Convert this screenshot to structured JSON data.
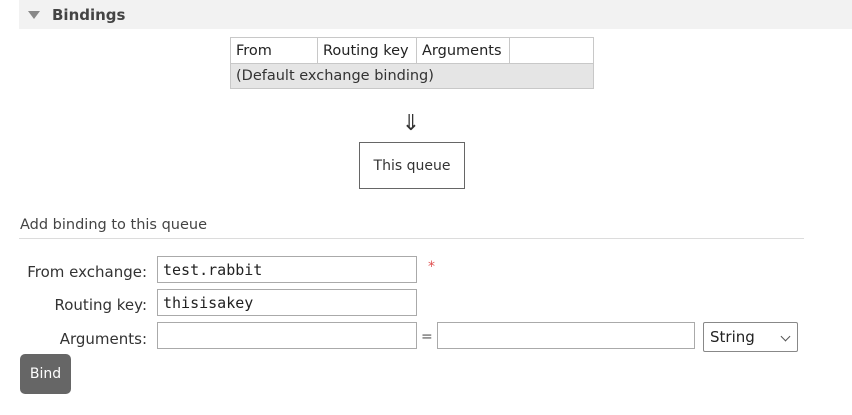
{
  "section": {
    "title": "Bindings"
  },
  "bindings_table": {
    "columns": [
      "From",
      "Routing key",
      "Arguments"
    ],
    "default_row": "(Default exchange binding)"
  },
  "flow": {
    "arrow": "⇓",
    "queue_label": "This queue"
  },
  "add_binding": {
    "title": "Add binding to this queue",
    "from_exchange_label": "From exchange:",
    "from_exchange_value": "test.rabbit",
    "required_marker": "*",
    "routing_key_label": "Routing key:",
    "routing_key_value": "thisisakey",
    "arguments_label": "Arguments:",
    "arguments_key_value": "",
    "equals": "=",
    "arguments_value": "",
    "type_selected": "String",
    "bind_button": "Bind"
  },
  "icons": {
    "section_toggle": "triangle-down-icon",
    "select_arrow": "chevron-down-icon"
  }
}
